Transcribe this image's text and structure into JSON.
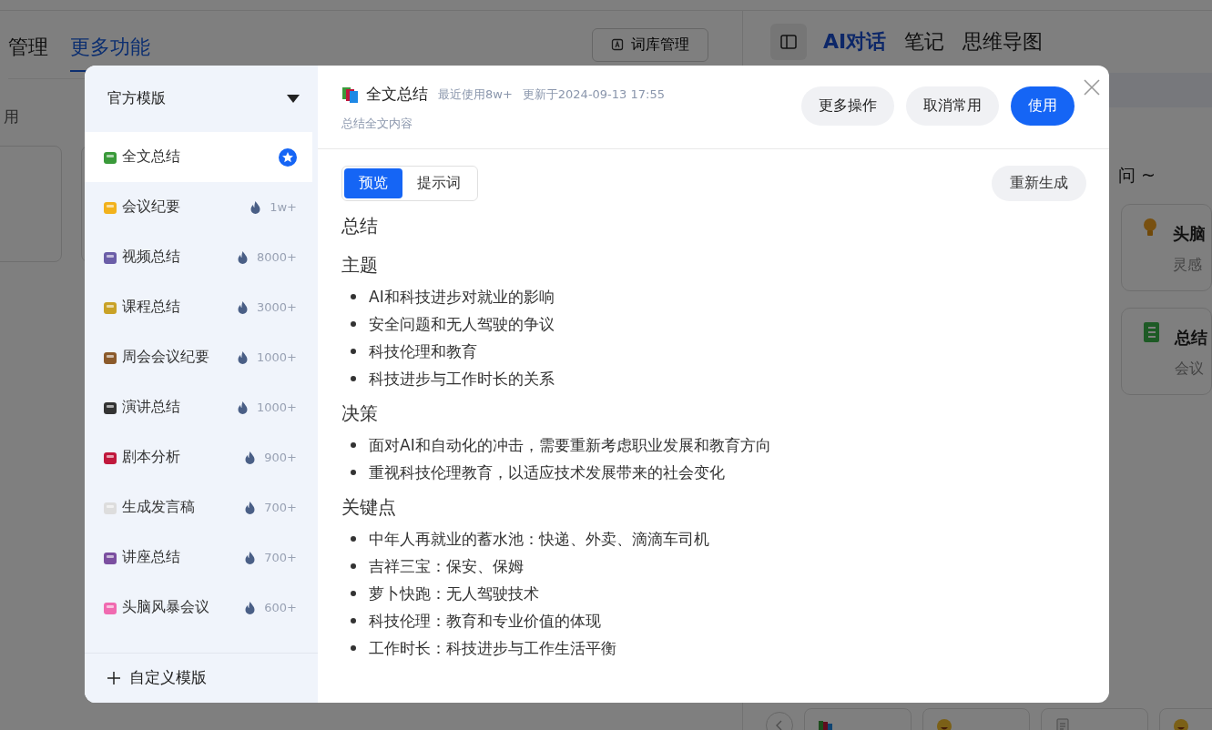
{
  "background": {
    "left_tabs": [
      {
        "label": "管理",
        "selected": false
      },
      {
        "label": "更多功能",
        "selected": true
      }
    ],
    "lexicon_button": "词库管理",
    "section_label": "用",
    "right_tabs": [
      {
        "label": "AI对话",
        "selected": true
      },
      {
        "label": "笔记",
        "selected": false
      },
      {
        "label": "思维导图",
        "selected": false
      }
    ],
    "prompt_hint": "问 ~",
    "cards": [
      {
        "title": "头脑",
        "subtitle": "灵感",
        "kind": "bulb"
      },
      {
        "title": "总结",
        "subtitle": "会议",
        "kind": "notebook"
      }
    ],
    "chips": [
      {
        "kind": "books"
      },
      {
        "kind": "smile"
      },
      {
        "kind": "doc"
      },
      {
        "kind": "smile"
      }
    ]
  },
  "dialog": {
    "category": "官方模版",
    "templates": [
      {
        "label": "全文总结",
        "favorite": true,
        "selected": true
      },
      {
        "label": "会议纪要",
        "count": "1w+",
        "favorite": false,
        "selected": false
      },
      {
        "label": "视频总结",
        "count": "8000+",
        "favorite": false,
        "selected": false
      },
      {
        "label": "课程总结",
        "count": "3000+",
        "favorite": false,
        "selected": false
      },
      {
        "label": "周会会议纪要",
        "count": "1000+",
        "favorite": false,
        "selected": false
      },
      {
        "label": "演讲总结",
        "count": "1000+",
        "favorite": false,
        "selected": false
      },
      {
        "label": "剧本分析",
        "count": "900+",
        "favorite": false,
        "selected": false
      },
      {
        "label": "生成发言稿",
        "count": "700+",
        "favorite": false,
        "selected": false
      },
      {
        "label": "讲座总结",
        "count": "700+",
        "favorite": false,
        "selected": false
      },
      {
        "label": "头脑风暴会议",
        "count": "600+",
        "favorite": false,
        "selected": false
      }
    ],
    "custom_button": "自定义模版",
    "title": "全文总结",
    "recent_use": "最近使用8w+",
    "updated": "更新于2024-09-13 17:55",
    "description": "总结全文内容",
    "actions": [
      {
        "label": "更多操作",
        "primary": false
      },
      {
        "label": "取消常用",
        "primary": false
      },
      {
        "label": "使用",
        "primary": true
      }
    ],
    "view_tabs": [
      {
        "label": "预览",
        "selected": true
      },
      {
        "label": "提示词",
        "selected": false
      }
    ],
    "regenerate_button": "重新生成",
    "preview_title": "总结",
    "sections": [
      {
        "heading": "主题",
        "items": [
          "AI和科技进步对就业的影响",
          "安全问题和无人驾驶的争议",
          "科技伦理和教育",
          "科技进步与工作时长的关系"
        ]
      },
      {
        "heading": "决策",
        "items": [
          "面对AI和自动化的冲击，需要重新考虑职业发展和教育方向",
          "重视科技伦理教育，以适应技术发展带来的社会变化"
        ]
      },
      {
        "heading": "关键点",
        "items": [
          "中年人再就业的蓄水池：快递、外卖、滴滴车司机",
          "吉祥三宝：保安、保姆",
          "萝卜快跑：无人驾驶技术",
          "科技伦理：教育和专业价值的体现",
          "工作时长：科技进步与工作生活平衡"
        ]
      }
    ]
  }
}
